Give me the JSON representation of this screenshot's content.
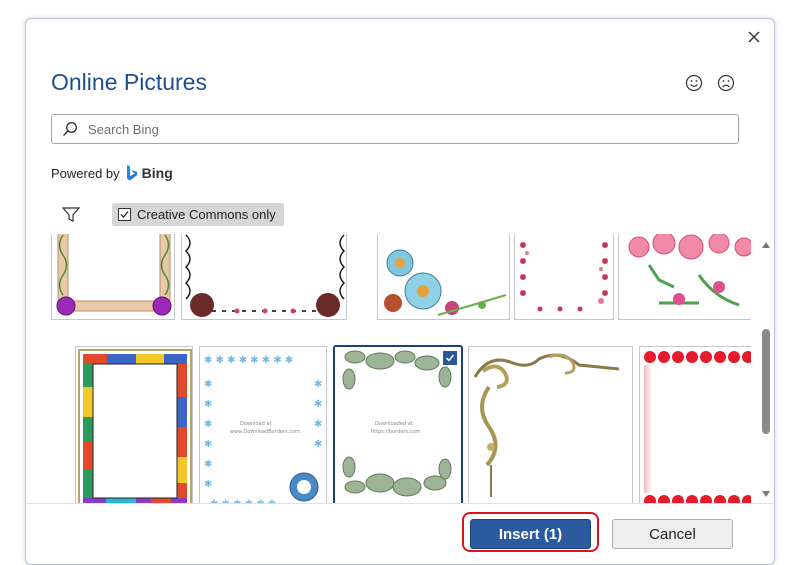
{
  "dialog": {
    "title": "Online Pictures",
    "close_icon": "close-icon",
    "feedback": {
      "smile_icon": "smile-icon",
      "frown_icon": "frown-icon"
    }
  },
  "search": {
    "placeholder": "Search Bing",
    "value": ""
  },
  "powered_by": {
    "label": "Powered by",
    "brand": "Bing"
  },
  "filters": {
    "filter_icon": "filter-icon",
    "creative_commons_label": "Creative Commons only",
    "creative_commons_checked": true
  },
  "gallery": {
    "selected_index": 7,
    "row1": [
      "frame-vine-purple-gems",
      "frame-black-ornament-horse",
      "frame-blue-flowers",
      "frame-pink-hearts-vertical",
      "frame-pink-roses"
    ],
    "row2": [
      "frame-stained-glass",
      "frame-blue-snowflakes",
      "frame-green-leaves",
      "frame-gold-corner-scroll",
      "frame-red-hearts"
    ]
  },
  "thumb_text": {
    "snow": [
      "Download at",
      "www.DownloadBorders.com"
    ],
    "leaf": [
      "Downloaded at",
      "https://borders.com"
    ]
  },
  "buttons": {
    "insert_label": "Insert (1)",
    "cancel_label": "Cancel"
  },
  "colors": {
    "accent": "#2c5a9e",
    "title": "#1f4e8c",
    "highlight_ring": "#d9141f"
  }
}
